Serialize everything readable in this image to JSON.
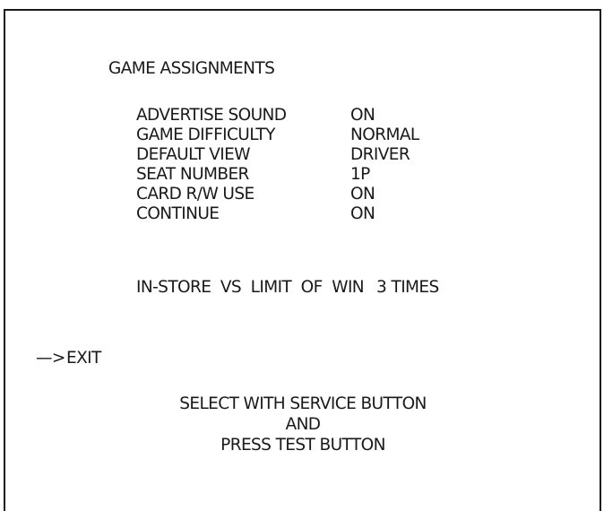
{
  "title": "GAME ASSIGNMENTS",
  "settings": [
    {
      "label": "ADVERTISE SOUND",
      "value": "ON"
    },
    {
      "label": "GAME DIFFICULTY",
      "value": "NORMAL"
    },
    {
      "label": "DEFAULT VIEW",
      "value": "DRIVER"
    },
    {
      "label": "SEAT NUMBER",
      "value": "1P"
    },
    {
      "label": "CARD R/W USE",
      "value": "ON"
    },
    {
      "label": "CONTINUE",
      "value": "ON"
    }
  ],
  "limit": {
    "label": "IN-STORE  VS  LIMIT  OF  WIN",
    "value": "3 TIMES"
  },
  "menu": {
    "cursor": "—>",
    "exit_label": "EXIT"
  },
  "instructions": {
    "line1": "SELECT WITH SERVICE BUTTON",
    "line2": "AND",
    "line3": "PRESS TEST BUTTON"
  }
}
